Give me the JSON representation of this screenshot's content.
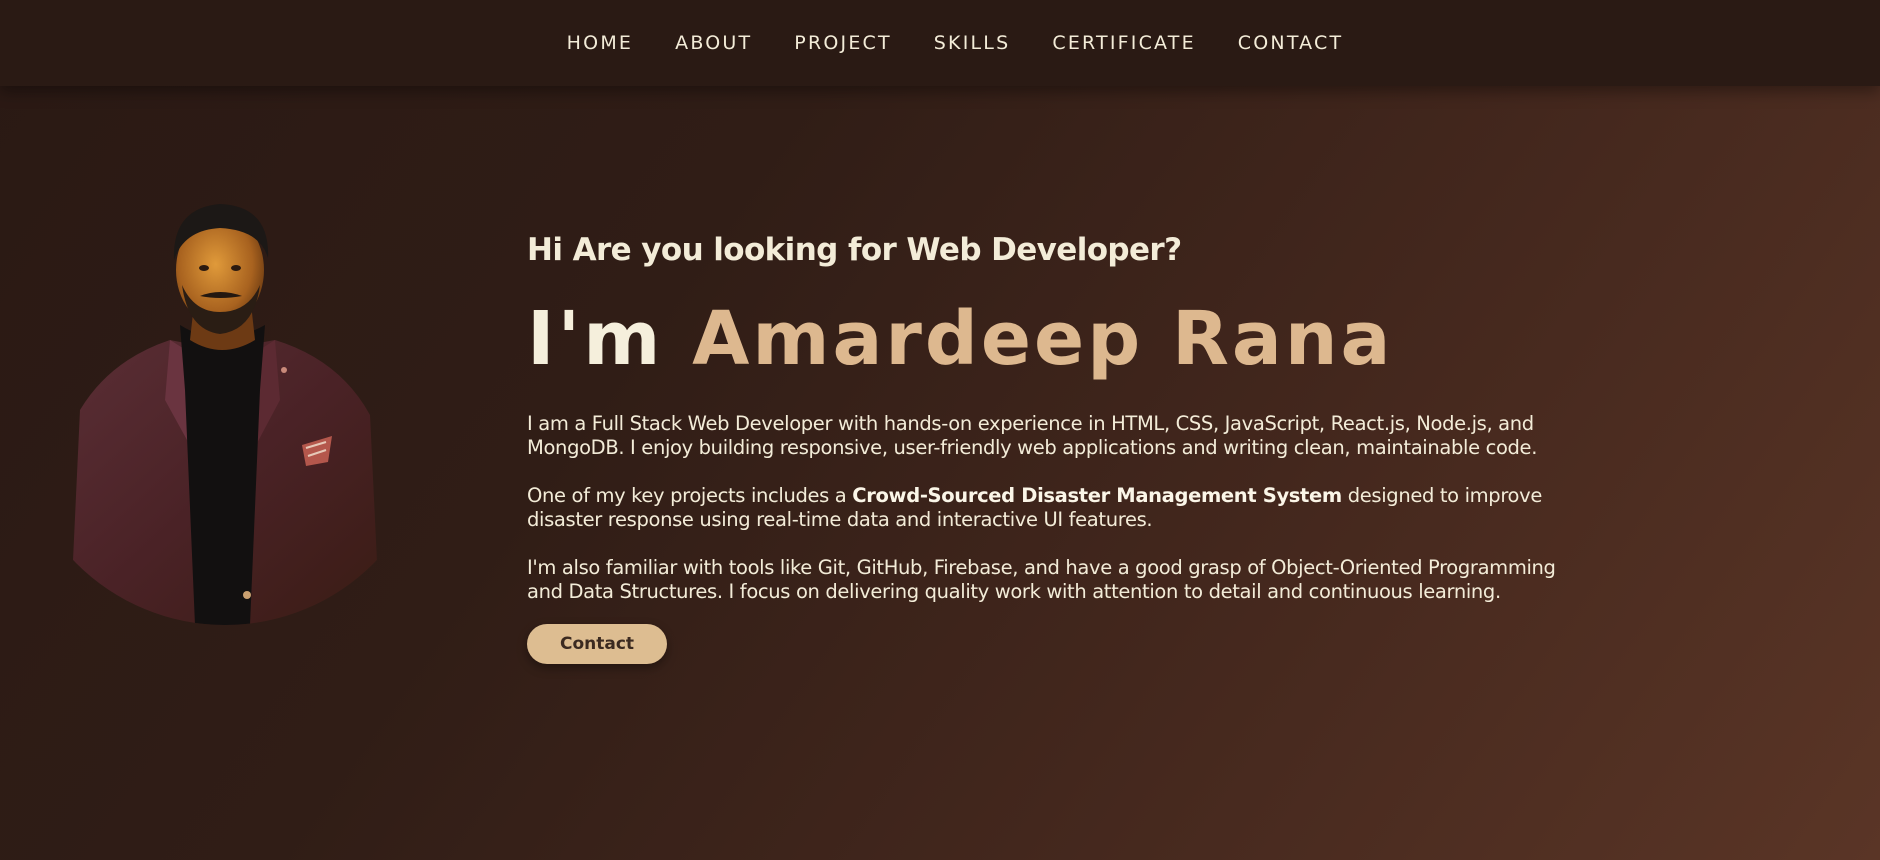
{
  "nav": {
    "items": [
      {
        "label": "HOME"
      },
      {
        "label": "ABOUT"
      },
      {
        "label": "PROJECT"
      },
      {
        "label": "SKILLS"
      },
      {
        "label": "CERTIFICATE"
      },
      {
        "label": "CONTACT"
      }
    ]
  },
  "hero": {
    "greeting": "Hi Are you looking for Web Developer?",
    "headline_prefix": "I'm ",
    "headline_name": "Amardeep Rana",
    "paragraph1": "I am a Full Stack Web Developer with hands-on experience in HTML, CSS, JavaScript, React.js, Node.js, and MongoDB. I enjoy building responsive, user-friendly web applications and writing clean, maintainable code.",
    "paragraph2_before": "One of my key projects includes a ",
    "paragraph2_bold": "Crowd-Sourced Disaster Management System",
    "paragraph2_after": " designed to improve disaster response using real-time data and interactive UI features.",
    "paragraph3": "I'm also familiar with tools like Git, GitHub, Firebase, and have a good grasp of Object-Oriented Programming and Data Structures. I focus on delivering quality work with attention to detail and continuous learning.",
    "contact_button": "Contact"
  },
  "colors": {
    "accent": "#ddb88f",
    "nav_background": "#2a1a14",
    "text": "#f3ecd8"
  }
}
